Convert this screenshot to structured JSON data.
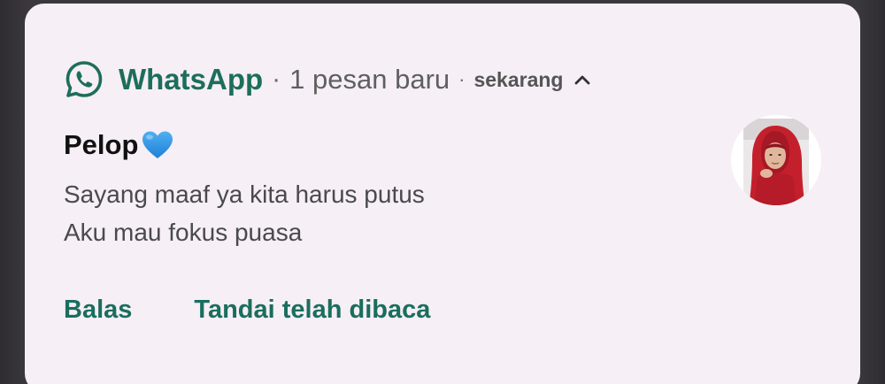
{
  "notification": {
    "app_name": "WhatsApp",
    "separator": "·",
    "new_message_text": "1 pesan baru",
    "time": "sekarang",
    "app_icon": "whatsapp-icon",
    "expand_icon": "chevron-up-icon",
    "sender": {
      "name": "Pelop",
      "emoji_icon": "blue-heart-icon"
    },
    "message_lines": [
      "Sayang maaf ya kita harus putus",
      "Aku mau fokus puasa"
    ],
    "avatar": "contact-avatar",
    "actions": [
      {
        "label": "Balas"
      },
      {
        "label": "Tandai telah dibaca"
      }
    ]
  },
  "colors": {
    "card_background": "#f6eff5",
    "brand_green": "#1d6e5c",
    "heart_blue": "#2a8fe0",
    "text_secondary": "#4a4a4a"
  }
}
